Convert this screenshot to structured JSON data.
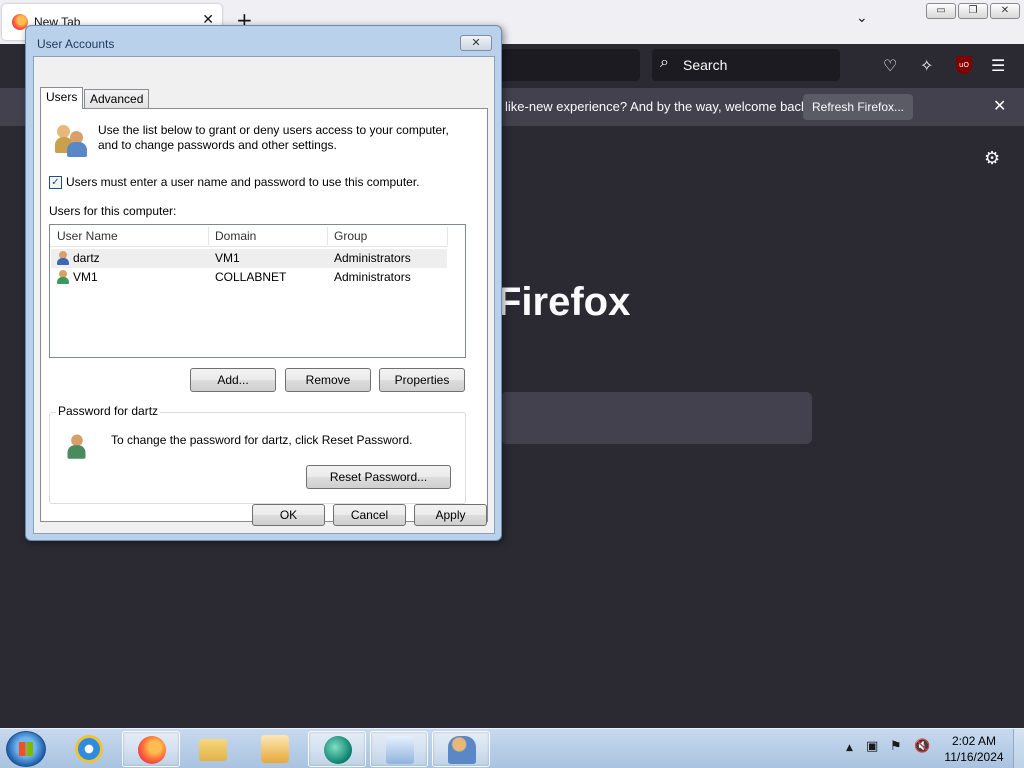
{
  "firefox": {
    "tab_title": "New Tab",
    "new_tab": "+",
    "tab_close": "✕",
    "tab_list": "⌄",
    "search_placeholder": "Search",
    "notice_text": "like-new experience? And by the way, welcome back!",
    "refresh_label": "Refresh Firefox...",
    "notice_close": "✕",
    "brand": "Firefox",
    "window_buttons": [
      "▭",
      "❐",
      "✕"
    ],
    "ublock_label": "uO"
  },
  "dialog": {
    "title": "User Accounts",
    "close": "✕",
    "tabs": [
      {
        "label": "Users",
        "active": true
      },
      {
        "label": "Advanced",
        "active": false
      }
    ],
    "intro": "Use the list below to grant or deny users access to your computer, and to change passwords and other settings.",
    "require_login_checked": true,
    "require_login_label": "Users must enter a user name and password to use this computer.",
    "users_label": "Users for this computer:",
    "columns": [
      "User Name",
      "Domain",
      "Group"
    ],
    "users": [
      {
        "name": "dartz",
        "domain": "VM1",
        "group": "Administrators",
        "selected": true
      },
      {
        "name": "VM1",
        "domain": "COLLABNET",
        "group": "Administrators",
        "selected": false
      }
    ],
    "add_label": "Add...",
    "remove_label": "Remove",
    "properties_label": "Properties",
    "password_group_title": "Password for dartz",
    "password_text": "To change the password for dartz, click Reset Password.",
    "reset_label": "Reset Password...",
    "ok_label": "OK",
    "cancel_label": "Cancel",
    "apply_label": "Apply"
  },
  "taskbar": {
    "time": "2:02 AM",
    "date": "11/16/2024",
    "tray_arrow": "▲",
    "colors": {
      "accent": "#1d5fa8",
      "taskbar": "#b8cfe8"
    }
  }
}
